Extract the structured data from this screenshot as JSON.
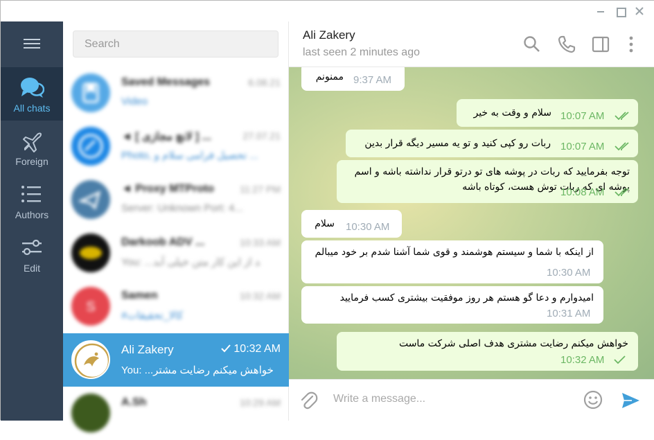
{
  "window": {
    "min_label": "minimize",
    "max_label": "maximize",
    "close_label": "close"
  },
  "rail": {
    "folders": [
      {
        "label": "All chats",
        "icon": "chats-icon"
      },
      {
        "label": "Foreign",
        "icon": "airplane-icon"
      },
      {
        "label": "Authors",
        "icon": "list-icon"
      },
      {
        "label": "Edit",
        "icon": "sliders-icon"
      }
    ]
  },
  "search": {
    "placeholder": "Search"
  },
  "chats": [
    {
      "name": "Saved Messages",
      "time": "6.08.21",
      "preview": "Video"
    },
    {
      "name": "◄ [ لانچ مجازی ] ...",
      "time": "27.07.21",
      "preview": "Photo, تحصیل فرامی سلام و ..."
    },
    {
      "name": "◄ Proxy MTProto",
      "time": "11:27 PM",
      "preview": "Server: Unknown Port: 4..."
    },
    {
      "name": "Darkoob ADV ...",
      "time": "10:33 AM",
      "preview": "You: ...بعد از این کار متن خیلی آبد"
    },
    {
      "name": "Samen",
      "time": "10:32 AM",
      "preview": "#کالا_تحقیقات"
    },
    {
      "name": "Ali Zakery",
      "time": "10:32 AM",
      "preview": "You: ...خواهش میکنم رضایت مشتر"
    },
    {
      "name": "A.Sh",
      "time": "10:29 AM",
      "preview": ""
    }
  ],
  "conversation": {
    "peer_name": "Ali Zakery",
    "peer_status": "last seen 2 minutes ago",
    "input_placeholder": "Write a message...",
    "messages": [
      {
        "dir": "in",
        "text": "ممنونم",
        "time": "9:37 AM"
      },
      {
        "dir": "out",
        "text": "سلام و وقت به خیر",
        "time": "10:07 AM"
      },
      {
        "dir": "out",
        "text": "ربات رو کپی کنید و تو یه مسیر دیگه قرار بدین",
        "time": "10:07 AM"
      },
      {
        "dir": "out",
        "text": "توجه بفرمایید که ربات در پوشه های تو درتو قرار نداشته باشه و اسم پوشه ای که ربات توش هست، کوتاه باشه",
        "time": "10:08 AM"
      },
      {
        "dir": "in",
        "text": "سلام",
        "time": "10:30 AM"
      },
      {
        "dir": "in",
        "text": "از اینکه با شما و سیستم هوشمند و قوی شما آشنا شدم بر خود میبالم",
        "time": "10:30 AM"
      },
      {
        "dir": "in",
        "text": "امیدوارم و دعا گو هستم هر روز موفقیت بیشتری کسب فرمایید",
        "time": "10:31 AM"
      },
      {
        "dir": "out",
        "text": "خواهش میکنم رضایت مشتری هدف اصلی شرکت ماست",
        "time": "10:32 AM"
      }
    ]
  },
  "colors": {
    "rail_bg": "#334356",
    "accent": "#419fd9",
    "out_bubble": "#effdde",
    "check": "#6cb764"
  }
}
